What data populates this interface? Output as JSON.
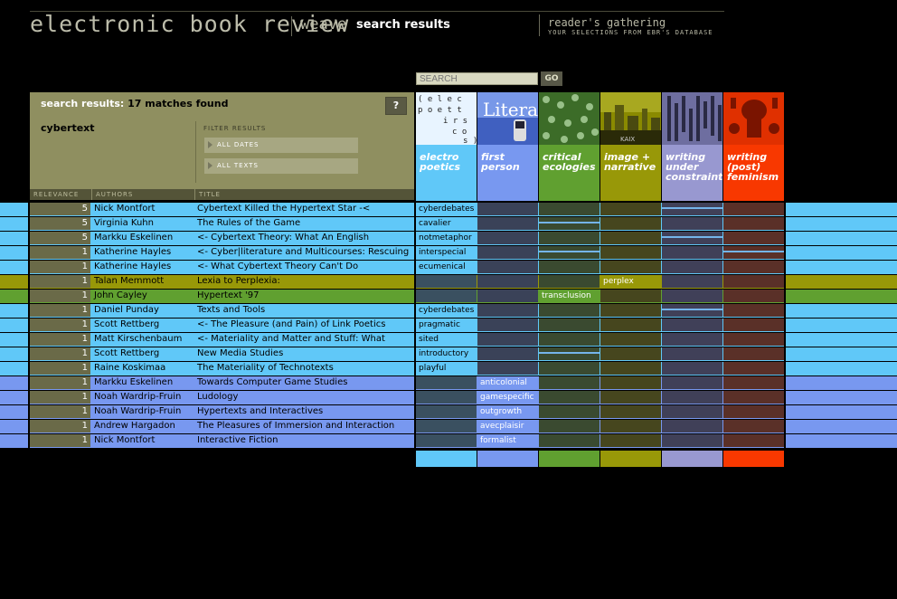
{
  "header": {
    "logo": "electronic book review",
    "section": "weave",
    "crumb": "search results",
    "readers_title": "reader's gathering",
    "readers_sub": "YOUR SELECTIONS FROM EBR'S DATABASE"
  },
  "search": {
    "placeholder": "SEARCH",
    "go_label": "GO"
  },
  "results": {
    "label": "search results:",
    "count_text": "17 matches found",
    "help_label": "?",
    "query": "cybertext",
    "filter_label": "FILTER RESULTS",
    "filter_dates": "ALL DATES",
    "filter_texts": "ALL TEXTS",
    "col_relevance": "RELEVANCE",
    "col_authors": "AUTHORS",
    "col_title": "TITLE"
  },
  "colors": {
    "electropoetics": "#60c8f8",
    "firstperson": "#7898f0",
    "critical": "#60a030",
    "image": "#989808",
    "writing_under": "#9898d0",
    "feminism": "#f83800",
    "relevance_bg": "#6a6a48"
  },
  "threads": [
    {
      "name": "electro poetics",
      "key": "electropoetics",
      "icon": "concrete-poetry-icon"
    },
    {
      "name": "first person",
      "key": "firstperson",
      "icon": "literal-phone-icon"
    },
    {
      "name": "critical ecologies",
      "key": "critical",
      "icon": "leaf-pattern-icon"
    },
    {
      "name": "image + narrative",
      "key": "image",
      "icon": "cityscape-icon"
    },
    {
      "name": "writing under constraint",
      "key": "writing_under",
      "icon": "bars-pattern-icon"
    },
    {
      "name": "writing (post) feminism",
      "key": "feminism",
      "icon": "figure-pattern-icon"
    }
  ],
  "rows": [
    {
      "rel": "5",
      "author": "Nick Montfort",
      "title": "Cybertext Killed the Hypertext Star -<",
      "thread": "electropoetics",
      "tags": [
        "cyberdebates",
        "",
        "",
        "",
        "",
        ""
      ],
      "bars": [
        4
      ]
    },
    {
      "rel": "5",
      "author": "Virginia Kuhn",
      "title": "The Rules of the Game",
      "thread": "electropoetics",
      "tags": [
        "cavalier",
        "",
        "",
        "",
        "",
        ""
      ],
      "bars": [
        2
      ]
    },
    {
      "rel": "5",
      "author": "Markku Eskelinen",
      "title": "<- Cybertext Theory: What An English",
      "thread": "electropoetics",
      "tags": [
        "notmetaphor",
        "",
        "",
        "",
        "",
        ""
      ],
      "bars": [
        4
      ]
    },
    {
      "rel": "1",
      "author": "Katherine Hayles",
      "title": "<- Cyber|literature and Multicourses: Rescuing",
      "thread": "electropoetics",
      "tags": [
        "interspecial",
        "",
        "",
        "",
        "",
        ""
      ],
      "bars": [
        2,
        5
      ]
    },
    {
      "rel": "1",
      "author": "Katherine Hayles",
      "title": "<- What Cybertext Theory Can't Do",
      "thread": "electropoetics",
      "tags": [
        "ecumenical",
        "",
        "",
        "",
        "",
        ""
      ],
      "bars": []
    },
    {
      "rel": "1",
      "author": "Talan Memmott",
      "title": "Lexia to Perplexia:",
      "thread": "image",
      "tags": [
        "",
        "",
        "",
        "perplex",
        "",
        ""
      ],
      "bars": []
    },
    {
      "rel": "1",
      "author": "John Cayley",
      "title": "Hypertext '97",
      "thread": "critical",
      "tags": [
        "",
        "",
        "transclusion",
        "",
        "",
        ""
      ],
      "bars": []
    },
    {
      "rel": "1",
      "author": "Daniel Punday",
      "title": "Texts and Tools",
      "thread": "electropoetics",
      "tags": [
        "cyberdebates",
        "",
        "",
        "",
        "",
        ""
      ],
      "bars": [
        4
      ]
    },
    {
      "rel": "1",
      "author": "Scott Rettberg",
      "title": "<- The Pleasure (and Pain) of Link Poetics",
      "thread": "electropoetics",
      "tags": [
        "pragmatic",
        "",
        "",
        "",
        "",
        ""
      ],
      "bars": []
    },
    {
      "rel": "1",
      "author": "Matt Kirschenbaum",
      "title": "<- Materiality and Matter and Stuff: What",
      "thread": "electropoetics",
      "tags": [
        "sited",
        "",
        "",
        "",
        "",
        ""
      ],
      "bars": []
    },
    {
      "rel": "1",
      "author": "Scott Rettberg",
      "title": "New Media Studies",
      "thread": "electropoetics",
      "tags": [
        "introductory",
        "",
        "",
        "",
        "",
        ""
      ],
      "bars": [
        2
      ]
    },
    {
      "rel": "1",
      "author": "Raine Koskimaa",
      "title": "The Materiality of Technotexts",
      "thread": "electropoetics",
      "tags": [
        "playful",
        "",
        "",
        "",
        "",
        ""
      ],
      "bars": []
    },
    {
      "rel": "1",
      "author": "Markku Eskelinen",
      "title": "Towards Computer Game Studies",
      "thread": "firstperson",
      "tags": [
        "",
        "anticolonial",
        "",
        "",
        "",
        ""
      ],
      "bars": []
    },
    {
      "rel": "1",
      "author": "Noah Wardrip-Fruin",
      "title": "Ludology",
      "thread": "firstperson",
      "tags": [
        "",
        "gamespecific",
        "",
        "",
        "",
        ""
      ],
      "bars": []
    },
    {
      "rel": "1",
      "author": "Noah Wardrip-Fruin",
      "title": "Hypertexts and Interactives",
      "thread": "firstperson",
      "tags": [
        "",
        "outgrowth",
        "",
        "",
        "",
        ""
      ],
      "bars": []
    },
    {
      "rel": "1",
      "author": "Andrew Hargadon",
      "title": "The Pleasures of Immersion and Interaction",
      "thread": "firstperson",
      "tags": [
        "",
        "avecplaisir",
        "",
        "",
        "",
        ""
      ],
      "bars": []
    },
    {
      "rel": "1",
      "author": "Nick Montfort",
      "title": "Interactive Fiction",
      "thread": "firstperson",
      "tags": [
        "",
        "formalist",
        "",
        "",
        "",
        ""
      ],
      "bars": []
    }
  ]
}
